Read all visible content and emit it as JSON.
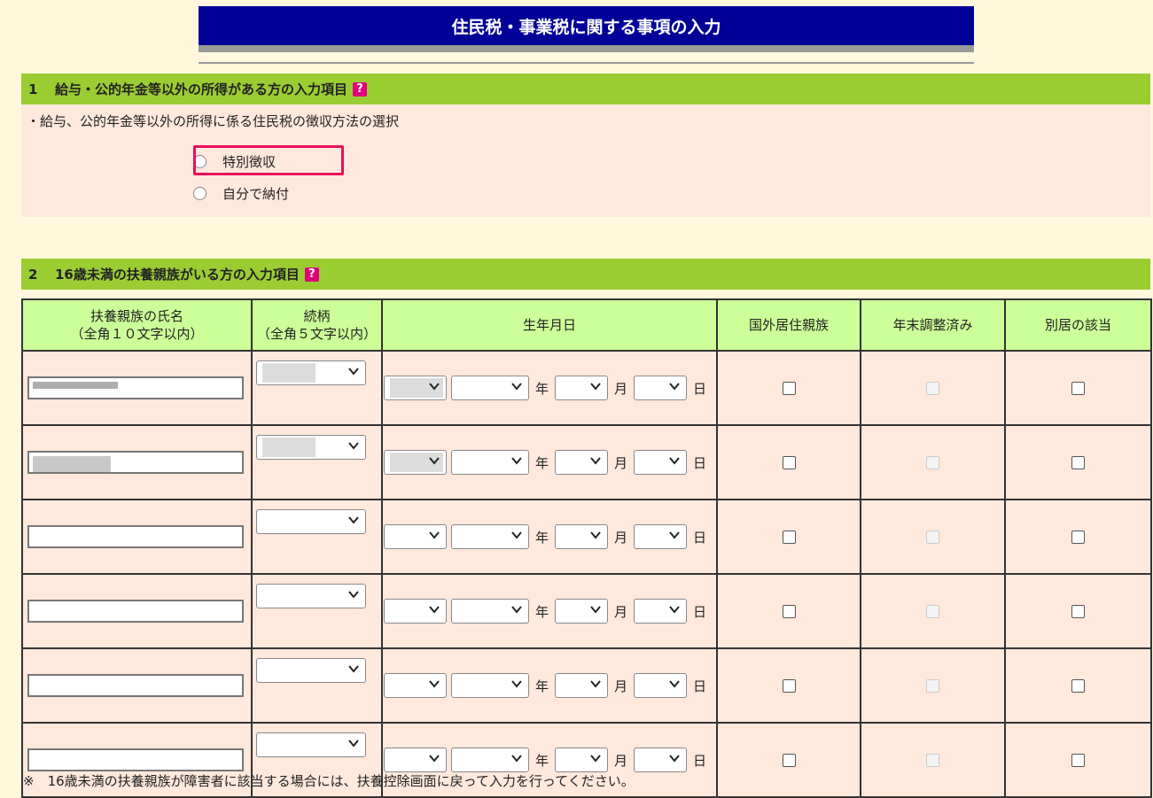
{
  "page_title": "住民税・事業税に関する事項の入力",
  "section1": {
    "number": "1",
    "title": "給与・公的年金等以外の所得がある方の入力項目",
    "help_icon": "?",
    "description": "・給与、公的年金等以外の所得に係る住民税の徴収方法の選択",
    "options": [
      "特別徴収",
      "自分で納付"
    ]
  },
  "section2": {
    "number": "2",
    "title": "16歳未満の扶養親族がいる方の入力項目",
    "help_icon": "?",
    "columns": {
      "name": "扶養親族の氏名",
      "name_hint": "（全角１０文字以内）",
      "relation": "続柄",
      "relation_hint": "（全角５文字以内）",
      "dob": "生年月日",
      "overseas": "国外居住親族",
      "year_end": "年末調整済み",
      "separate": "別居の該当"
    },
    "date_labels": {
      "year": "年",
      "month": "月",
      "day": "日"
    }
  },
  "footnote": "※　16歳未満の扶養親族が障害者に該当する場合には、扶養控除画面に戻って入力を行ってください。"
}
